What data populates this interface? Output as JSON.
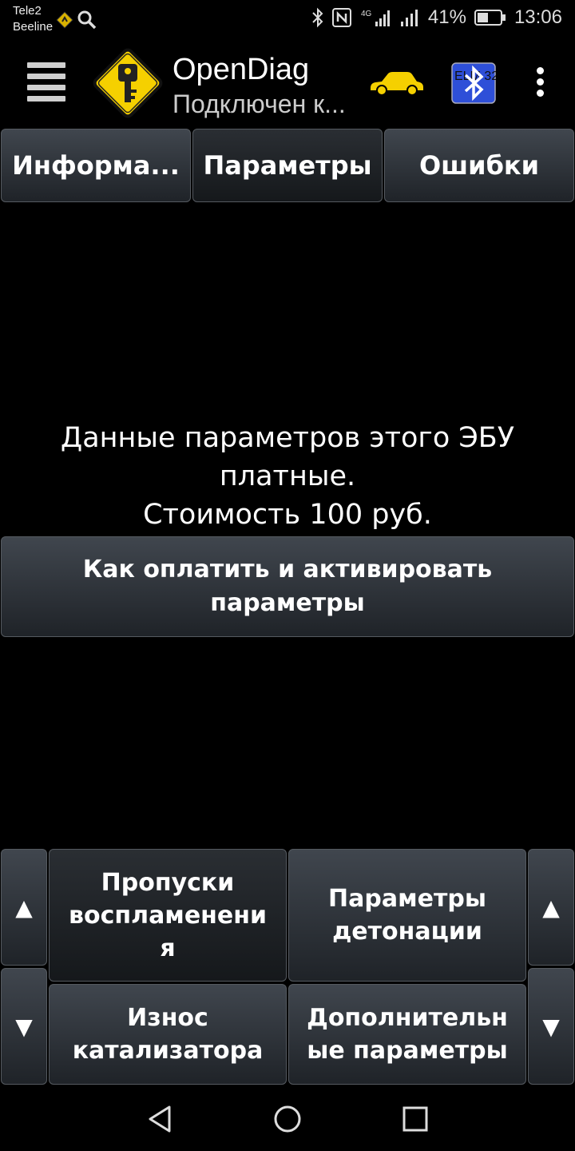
{
  "status": {
    "carrier1": "Tele2",
    "carrier2": "Beeline",
    "network": "4G",
    "battery": "41%",
    "time": "13:06"
  },
  "appbar": {
    "title": "OpenDiag",
    "subtitle": "Подключен к...",
    "logo": "key-logo-icon",
    "bluetooth_label": "ELM 327"
  },
  "tabs": [
    {
      "label": "Информа..."
    },
    {
      "label": "Параметры",
      "active": true
    },
    {
      "label": "Ошибки"
    }
  ],
  "message": {
    "line1": "Данные параметров этого ЭБУ",
    "line2": "платные.",
    "line3": "Стоимость 100 руб."
  },
  "pay_button": {
    "line1": "Как оплатить и активировать",
    "line2": "параметры"
  },
  "bottom_grid": {
    "up": "▲",
    "down": "▼",
    "items": [
      {
        "line1": "Пропуски",
        "line2": "воспламенени",
        "line3": "я"
      },
      {
        "line1": "Параметры",
        "line2": "детонации"
      },
      {
        "line1": "Износ",
        "line2": "катализатора"
      },
      {
        "line1": "Дополнительн",
        "line2": "ые параметры"
      }
    ]
  },
  "colors": {
    "accent_yellow": "#f5d000",
    "bluetooth_blue": "#2e4fd8"
  }
}
